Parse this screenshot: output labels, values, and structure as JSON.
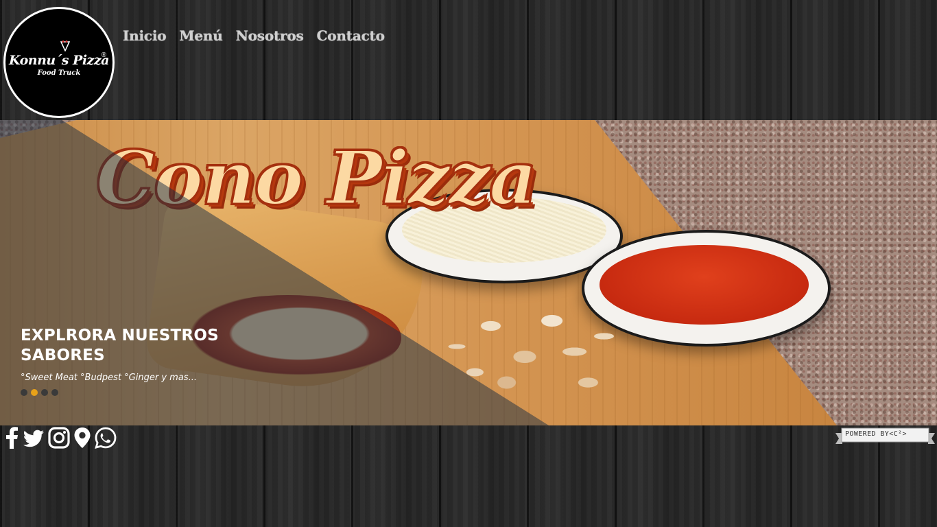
{
  "logo": {
    "name": "Konnu´s Pizza",
    "tagline": "Food Truck",
    "registered": "®"
  },
  "nav": {
    "items": [
      {
        "label": "Inicio"
      },
      {
        "label": "Menú"
      },
      {
        "label": "Nosotros"
      },
      {
        "label": "Contacto"
      }
    ]
  },
  "hero": {
    "banner_text": "Cono Pizza",
    "slide_title": "EXPLRORA NUESTROS SABORES",
    "slide_text": "°Sweet Meat °Budpest °Ginger y mas...",
    "slide_count": 4,
    "active_slide": 2,
    "active_dot_color": "#e8a219"
  },
  "social": {
    "icons": [
      "facebook-icon",
      "twitter-icon",
      "instagram-icon",
      "location-pin-icon",
      "whatsapp-icon"
    ]
  },
  "footer": {
    "powered_by": "POWERED BY<C²>"
  }
}
